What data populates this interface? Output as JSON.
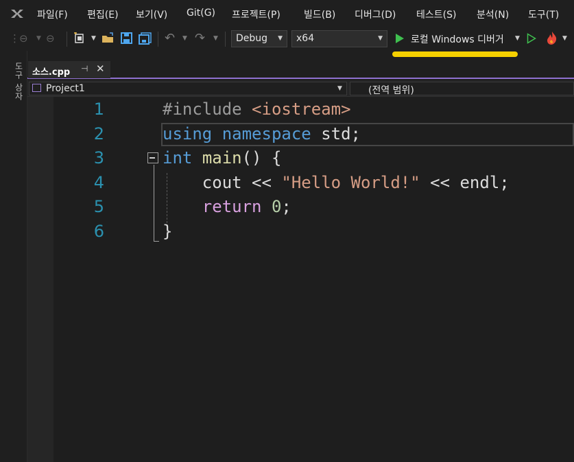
{
  "menu": {
    "items": [
      "파일(F)",
      "편집(E)",
      "보기(V)",
      "Git(G)",
      "프로젝트(P)",
      "빌드(B)",
      "디버그(D)",
      "테스트(S)",
      "분석(N)",
      "도구(T)"
    ]
  },
  "toolbar": {
    "configuration": "Debug",
    "platform": "x64",
    "debugger_label": "로컬 Windows 디버거",
    "icons": [
      "back-icon",
      "forward-icon",
      "new-project-icon",
      "open-folder-icon",
      "save-icon",
      "save-all-icon",
      "undo-icon",
      "redo-icon",
      "start-debug-icon",
      "start-without-debug-icon",
      "hot-reload-icon"
    ],
    "highlight_color": "#f5d000"
  },
  "toolstrip": {
    "label": "도구 상자"
  },
  "tab": {
    "title": "소스.cpp",
    "pin": "⊣",
    "close": "✕"
  },
  "navbar": {
    "project": "Project1",
    "scope": "(전역 범위)"
  },
  "editor": {
    "line_numbers": [
      "1",
      "2",
      "3",
      "4",
      "5",
      "6"
    ],
    "lines": [
      [
        {
          "t": "#include ",
          "c": "pp"
        },
        {
          "t": "<iostream>",
          "c": "str"
        }
      ],
      [
        {
          "t": "using",
          "c": "kw"
        },
        {
          "t": " ",
          "c": "plain"
        },
        {
          "t": "namespace",
          "c": "kw"
        },
        {
          "t": " std;",
          "c": "plain"
        }
      ],
      [
        {
          "t": "int",
          "c": "kw"
        },
        {
          "t": " ",
          "c": "plain"
        },
        {
          "t": "main",
          "c": "fn"
        },
        {
          "t": "() {",
          "c": "plain"
        }
      ],
      [
        {
          "t": "    cout << ",
          "c": "plain"
        },
        {
          "t": "\"Hello World!\"",
          "c": "str"
        },
        {
          "t": " << endl;",
          "c": "plain"
        }
      ],
      [
        {
          "t": "    ",
          "c": "plain"
        },
        {
          "t": "return",
          "c": "ret"
        },
        {
          "t": " ",
          "c": "plain"
        },
        {
          "t": "0",
          "c": "num"
        },
        {
          "t": ";",
          "c": "plain"
        }
      ],
      [
        {
          "t": "}",
          "c": "plain"
        }
      ]
    ],
    "colors": {
      "keyword": "#569cd6",
      "function": "#dcdcaa",
      "string": "#d69d85",
      "preprocessor": "#9b9b9b",
      "control": "#d8a0df",
      "number": "#b5cea8",
      "line_number": "#2b91af"
    }
  }
}
